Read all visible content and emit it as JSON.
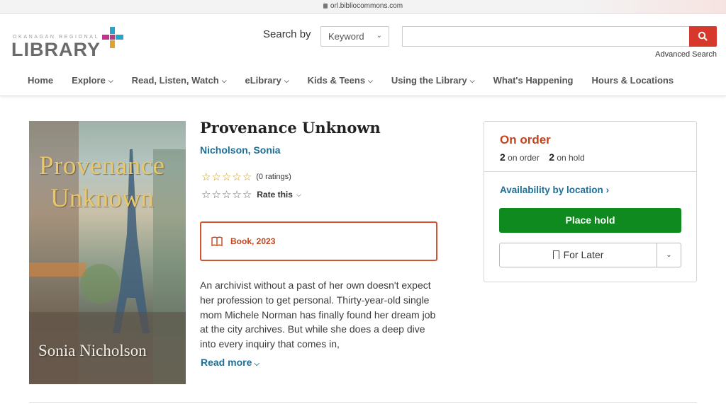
{
  "browser": {
    "url": "orl.bibliocommons.com"
  },
  "logo": {
    "small": "OKANAGAN REGIONAL",
    "big": "LIBRARY"
  },
  "search": {
    "label": "Search by",
    "type_selected": "Keyword",
    "query": "",
    "advanced_label": "Advanced Search",
    "button_color": "#d6392c"
  },
  "nav": {
    "items": [
      {
        "label": "Home",
        "dropdown": false
      },
      {
        "label": "Explore",
        "dropdown": true
      },
      {
        "label": "Read, Listen, Watch",
        "dropdown": true
      },
      {
        "label": "eLibrary",
        "dropdown": true
      },
      {
        "label": "Kids & Teens",
        "dropdown": true
      },
      {
        "label": "Using the Library",
        "dropdown": true
      },
      {
        "label": "What's Happening",
        "dropdown": false
      },
      {
        "label": "Hours & Locations",
        "dropdown": false
      }
    ]
  },
  "book": {
    "title": "Provenance Unknown",
    "author": "Nicholson, Sonia",
    "rating_stars": 0,
    "ratings_count": "(0 ratings)",
    "rate_label": "Rate this",
    "format": "Book, 2023",
    "description": "An archivist without a past of her own doesn't expect her profession to get personal. Thirty-year-old single mom Michele Norman has finally found her dream job at the city archives. But while she does a deep dive into every inquiry that comes in,",
    "read_more": "Read more",
    "cover": {
      "title_line1": "Provenance",
      "title_line2": "Unknown",
      "author": "Sonia Nicholson"
    }
  },
  "availability": {
    "status": "On order",
    "on_order_count": "2",
    "on_order_label": "on order",
    "on_hold_count": "2",
    "on_hold_label": "on hold",
    "availability_link": "Availability by location",
    "place_hold": "Place hold",
    "for_later": "For Later",
    "status_color": "#c2441c",
    "hold_color": "#0e8a1f"
  }
}
